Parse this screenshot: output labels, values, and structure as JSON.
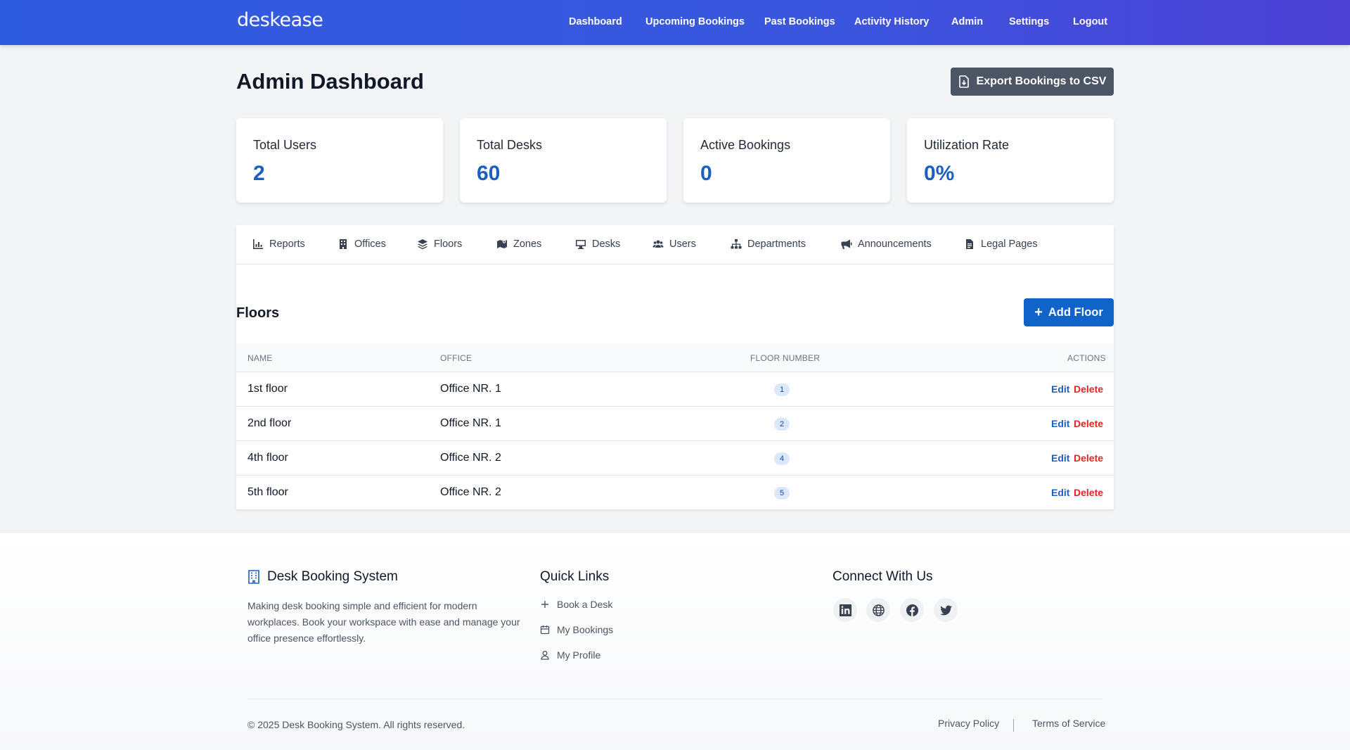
{
  "app": {
    "logo": "deskease"
  },
  "nav": {
    "dashboard": "Dashboard",
    "upcoming": "Upcoming Bookings",
    "past": "Past Bookings",
    "activity": "Activity History",
    "admin": "Admin",
    "settings": "Settings",
    "logout": "Logout"
  },
  "page": {
    "title": "Admin Dashboard",
    "export_label": "Export Bookings to CSV"
  },
  "stats": [
    {
      "label": "Total Users",
      "value": "2"
    },
    {
      "label": "Total Desks",
      "value": "60"
    },
    {
      "label": "Active Bookings",
      "value": "0"
    },
    {
      "label": "Utilization Rate",
      "value": "0%"
    }
  ],
  "tabs": [
    {
      "label": "Reports",
      "icon": "chart-icon"
    },
    {
      "label": "Offices",
      "icon": "building-icon"
    },
    {
      "label": "Floors",
      "icon": "layers-icon"
    },
    {
      "label": "Zones",
      "icon": "map-icon"
    },
    {
      "label": "Desks",
      "icon": "desktop-icon"
    },
    {
      "label": "Users",
      "icon": "users-icon"
    },
    {
      "label": "Departments",
      "icon": "sitemap-icon"
    },
    {
      "label": "Announcements",
      "icon": "megaphone-icon"
    },
    {
      "label": "Legal Pages",
      "icon": "document-icon"
    }
  ],
  "floors": {
    "title": "Floors",
    "add_label": "Add Floor",
    "columns": [
      "Name",
      "Office",
      "Floor Number",
      "Actions"
    ],
    "rows": [
      {
        "name": "1st floor",
        "office": "Office NR. 1",
        "number": "1"
      },
      {
        "name": "2nd floor",
        "office": "Office NR. 1",
        "number": "2"
      },
      {
        "name": "4th floor",
        "office": "Office NR. 2",
        "number": "4"
      },
      {
        "name": "5th floor",
        "office": "Office NR. 2",
        "number": "5"
      }
    ],
    "edit_label": "Edit",
    "delete_label": "Delete"
  },
  "footer": {
    "brand": "Desk Booking System",
    "description": "Making desk booking simple and efficient for modern workplaces. Book your workspace with ease and manage your office presence effortlessly.",
    "quick_links_title": "Quick Links",
    "quick_links": [
      "Book a Desk",
      "My Bookings",
      "My Profile"
    ],
    "connect_title": "Connect With Us",
    "social_icons": [
      "linkedin-icon",
      "globe-icon",
      "facebook-icon",
      "twitter-icon"
    ],
    "copyright": "© 2025 Desk Booking System. All rights reserved.",
    "privacy": "Privacy Policy",
    "terms": "Terms of Service"
  },
  "colors": {
    "header_start": "#2f5be0",
    "header_end": "#4c3fd4",
    "primary": "#1063c9",
    "stat_value": "#1d5fbf",
    "delete": "#dc2626",
    "export_button": "#4b5563"
  }
}
